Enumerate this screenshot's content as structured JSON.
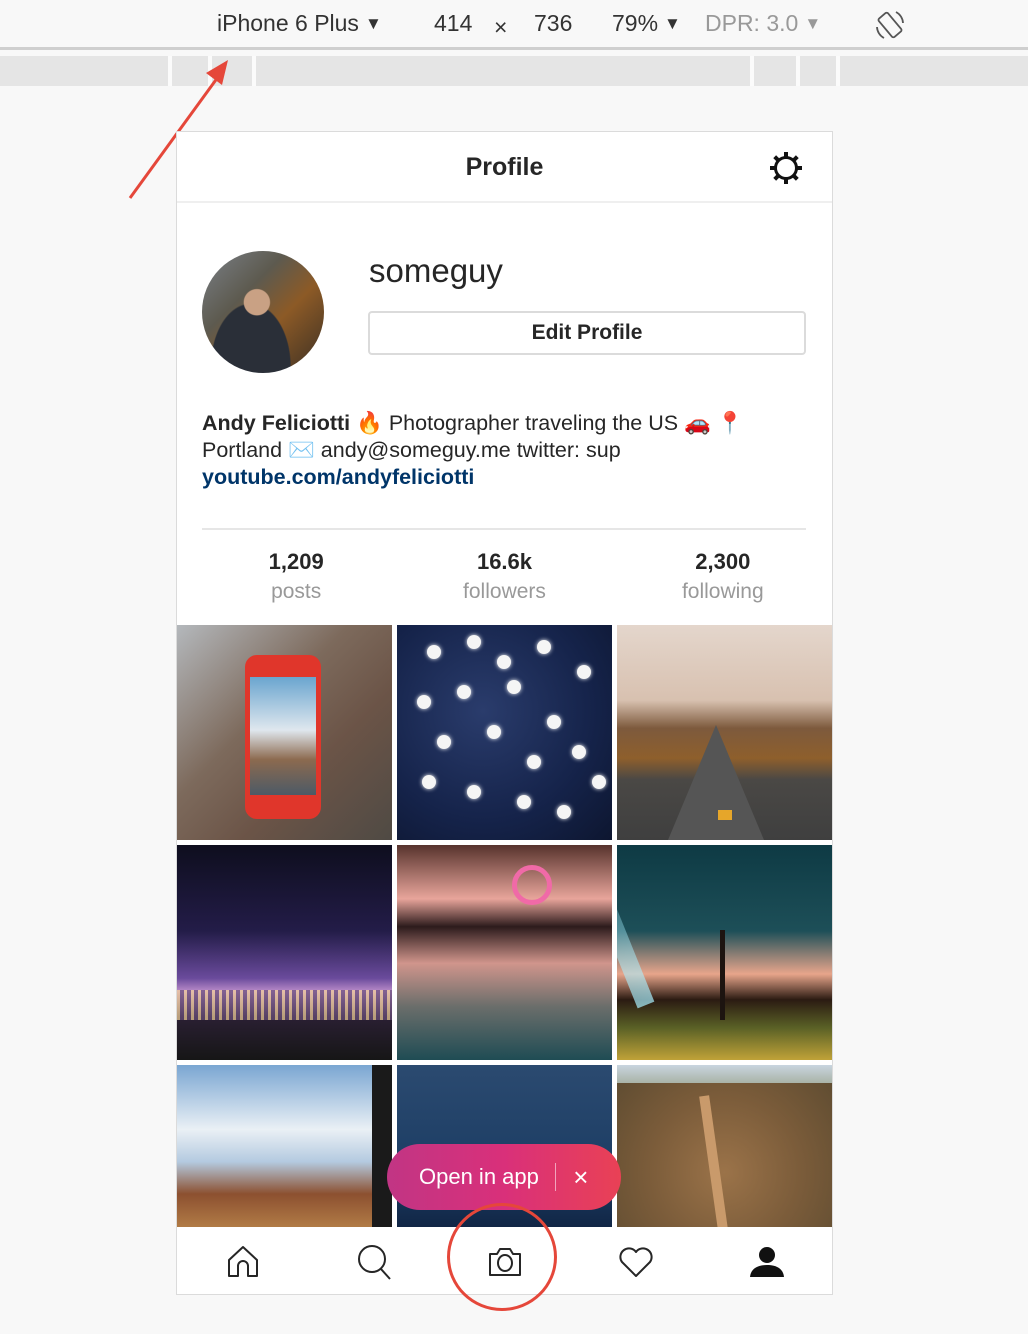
{
  "devtools": {
    "device": "iPhone 6 Plus",
    "width": "414",
    "times": "×",
    "height": "736",
    "zoom": "79%",
    "dpr": "DPR: 3.0",
    "dropdown_glyph": "▼"
  },
  "header": {
    "title": "Profile",
    "settings_icon": "gear-icon"
  },
  "profile": {
    "username": "someguy",
    "edit_button": "Edit Profile",
    "full_name": "Andy Feliciotti",
    "bio_line1": " 🔥 Photographer traveling the US 🚗 📍",
    "bio_line2": "Portland ✉️ andy@someguy.me twitter: sup",
    "link": "youtube.com/andyfeliciotti"
  },
  "stats": [
    {
      "value": "1,209",
      "label": "posts"
    },
    {
      "value": "16.6k",
      "label": "followers"
    },
    {
      "value": "2,300",
      "label": "following"
    }
  ],
  "grid": [
    {
      "subject": "red phone showing shipwreck"
    },
    {
      "subject": "street lamps under starry sky"
    },
    {
      "subject": "desert road with buttes"
    },
    {
      "subject": "city skyline at night with observatory"
    },
    {
      "subject": "pier ferris wheel reflection"
    },
    {
      "subject": "joshua tree with flashlight beam"
    },
    {
      "subject": "butte seen from car window"
    },
    {
      "subject": "star trails over landscape"
    },
    {
      "subject": "aerial dirt road through forest"
    }
  ],
  "banner": {
    "label": "Open in app",
    "close": "×"
  },
  "tabbar": [
    {
      "name": "home",
      "icon": "home-icon"
    },
    {
      "name": "search",
      "icon": "search-icon"
    },
    {
      "name": "camera",
      "icon": "camera-icon"
    },
    {
      "name": "activity",
      "icon": "heart-icon"
    },
    {
      "name": "profile",
      "icon": "person-icon"
    }
  ],
  "colors": {
    "annotation": "#e5473a",
    "link": "#003569",
    "banner_start": "#c13584",
    "banner_end": "#e94155"
  }
}
